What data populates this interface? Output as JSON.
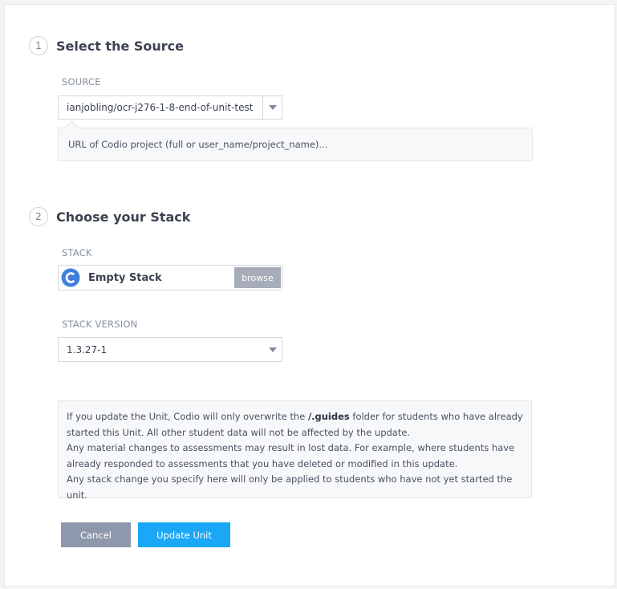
{
  "section1": {
    "number": "1",
    "title": "Select the Source",
    "source_label": "SOURCE",
    "source_value": "ianjobling/ocr-j276-1-8-end-of-unit-test",
    "hint": "URL of Codio project (full or user_name/project_name)..."
  },
  "section2": {
    "number": "2",
    "title": "Choose your Stack",
    "stack_label": "STACK",
    "stack_name": "Empty Stack",
    "stack_icon": "codio-logo-icon",
    "browse_label": "browse",
    "version_label": "STACK VERSION",
    "version_value": "1.3.27-1"
  },
  "notice": {
    "line1_prefix": "If you update the Unit, Codio will only overwrite the ",
    "line1_folder": "/.guides",
    "line1_suffix": " folder for students who have already started this Unit. All other student data will not be affected by the update.",
    "line2": "Any material changes to assessments may result in lost data. For example, where students have already responded to assessments that you have deleted or modified in this update.",
    "line3": "Any stack change you specify here will only be applied to students who have not yet started the unit."
  },
  "actions": {
    "cancel_label": "Cancel",
    "update_label": "Update Unit"
  },
  "colors": {
    "primary": "#1aa7f5",
    "secondary": "#8e98ad",
    "browse": "#a7adb8"
  }
}
